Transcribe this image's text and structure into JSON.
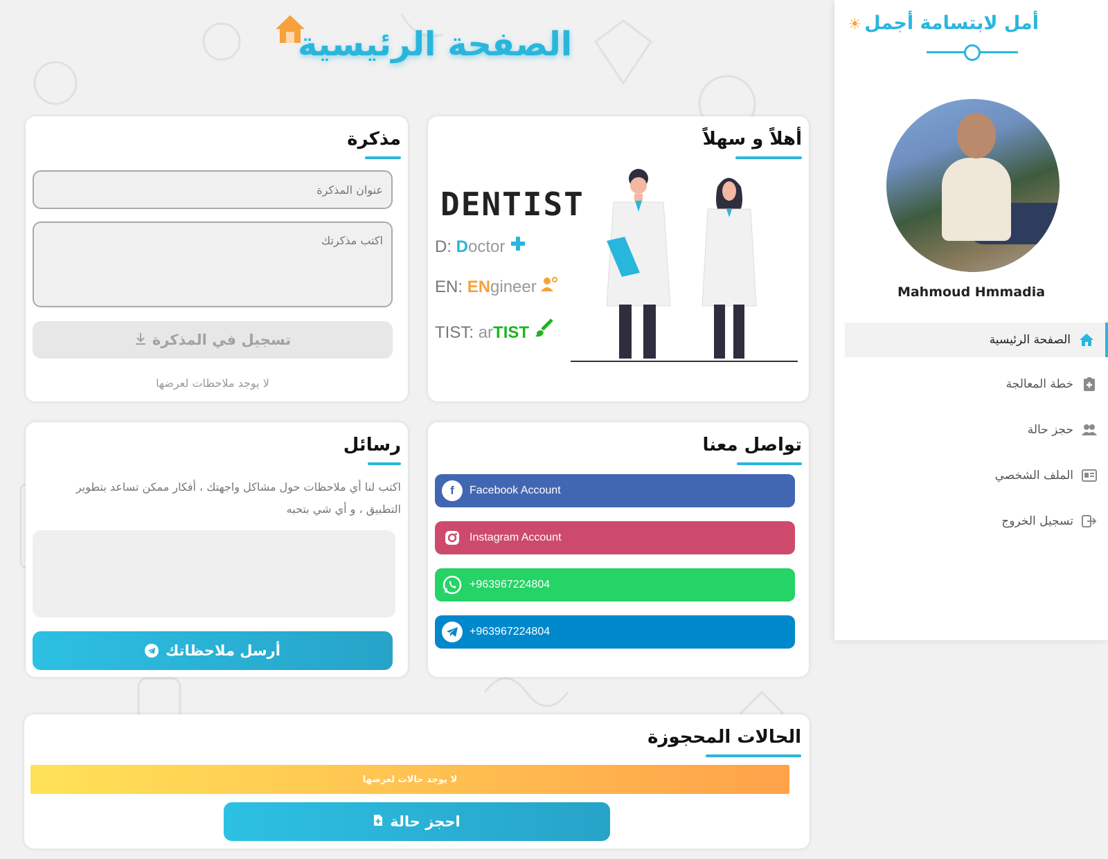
{
  "brand": {
    "title": "أمل لابتسامة أجمل",
    "sun_icon": "☀"
  },
  "user": {
    "name": "Mahmoud Hmmadia"
  },
  "nav": [
    {
      "label": "الصفحة الرئيسية",
      "icon": "home-icon",
      "active": true
    },
    {
      "label": "خطة المعالجة",
      "icon": "clipboard-plus-icon",
      "active": false
    },
    {
      "label": "حجز حالة",
      "icon": "users-icon",
      "active": false
    },
    {
      "label": "الملف الشخصي",
      "icon": "id-card-icon",
      "active": false
    },
    {
      "label": "تسجيل الخروج",
      "icon": "logout-icon",
      "active": false
    }
  ],
  "page": {
    "title": "الصفحة الرئيسية"
  },
  "welcome": {
    "title": "أهلاً و سهلاً",
    "logo": "DENTIST",
    "rows": [
      {
        "prefix": "D:",
        "highlight": "D",
        "rest": "octor",
        "icon": "plus-icon"
      },
      {
        "prefix": "EN:",
        "highlight": "EN",
        "rest": "gineer",
        "icon": "engineer-icon"
      },
      {
        "prefix": "TIST:",
        "rest": "ar",
        "highlight": "TIST",
        "icon": "brush-icon"
      }
    ]
  },
  "notes": {
    "title": "مذكرة",
    "title_placeholder": "عنوان المذكرة",
    "body_placeholder": "اكتب مذكرتك",
    "save_label": "تسجيل في المذكرة",
    "empty": "لا يوجد ملاحظات لعرضها"
  },
  "contact": {
    "title": "تواصل معنا",
    "items": [
      {
        "label": "Facebook Account",
        "icon": "facebook-icon",
        "color": "#4267b2"
      },
      {
        "label": "Instagram Account",
        "icon": "instagram-icon",
        "color": "#cd4a6c"
      },
      {
        "label": "+963967224804",
        "icon": "whatsapp-icon",
        "color": "#25d366"
      },
      {
        "label": "+963967224804",
        "icon": "telegram-icon",
        "color": "#0088cc"
      }
    ]
  },
  "messages": {
    "title": "رسائل",
    "text": "اكتب لنا أي ملاحظات حول مشاكل واجهتك ، أفكار ممكن تساعد بتطوير التطبيق ، و أي شي بتحبه",
    "send_label": "أرسل ملاحظاتك"
  },
  "bookings": {
    "title": "الحالات المحجوزة",
    "empty": "لا يوجد حالات لعرضها",
    "book_label": "احجز حالة"
  },
  "colors": {
    "accent": "#29b6dd",
    "orange": "#f7a13a",
    "green": "#1eb51e"
  }
}
